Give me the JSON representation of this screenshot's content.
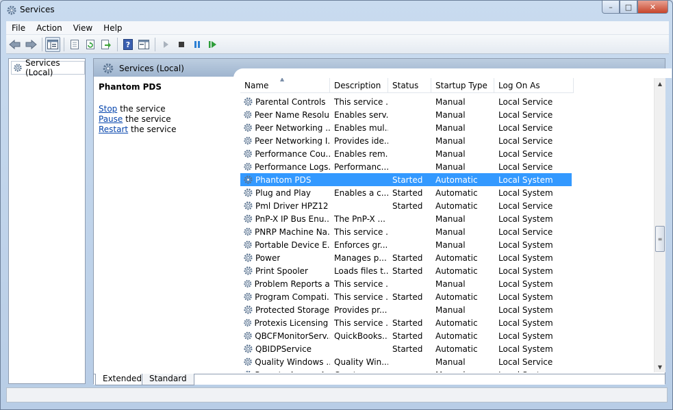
{
  "window": {
    "title": "Services",
    "icon": "services-gear-icon"
  },
  "caption": {
    "minimize": "–",
    "maximize": "□",
    "close": "✕"
  },
  "menu": [
    {
      "key": "file",
      "label": "File"
    },
    {
      "key": "action",
      "label": "Action"
    },
    {
      "key": "view",
      "label": "View"
    },
    {
      "key": "help",
      "label": "Help"
    }
  ],
  "toolbar": {
    "buttons": [
      "back-arrow-icon",
      "forward-arrow-icon",
      "show-hide-console-tree-icon",
      "properties-icon",
      "refresh-icon",
      "export-list-icon",
      "help-icon",
      "show-action-pane-icon",
      "start-service-icon",
      "stop-service-icon",
      "pause-service-icon",
      "restart-service-icon"
    ]
  },
  "tree": {
    "root_label": "Services (Local)"
  },
  "details": {
    "header_title": "Services (Local)",
    "service_name": "Phantom PDS",
    "actions": [
      {
        "link": "Stop",
        "rest": " the service"
      },
      {
        "link": "Pause",
        "rest": " the service"
      },
      {
        "link": "Restart",
        "rest": " the service"
      }
    ]
  },
  "list": {
    "columns": [
      "Name",
      "Description",
      "Status",
      "Startup Type",
      "Log On As"
    ],
    "rows": [
      {
        "name": "Parental Controls",
        "description": "This service ...",
        "status": "",
        "startup": "Manual",
        "logon": "Local Service"
      },
      {
        "name": "Peer Name Resolu...",
        "description": "Enables serv...",
        "status": "",
        "startup": "Manual",
        "logon": "Local Service"
      },
      {
        "name": "Peer Networking ...",
        "description": "Enables mul...",
        "status": "",
        "startup": "Manual",
        "logon": "Local Service"
      },
      {
        "name": "Peer Networking I...",
        "description": "Provides ide...",
        "status": "",
        "startup": "Manual",
        "logon": "Local Service"
      },
      {
        "name": "Performance Cou...",
        "description": "Enables rem...",
        "status": "",
        "startup": "Manual",
        "logon": "Local Service"
      },
      {
        "name": "Performance Logs...",
        "description": "Performanc...",
        "status": "",
        "startup": "Manual",
        "logon": "Local Service"
      },
      {
        "name": "Phantom PDS",
        "description": "",
        "status": "Started",
        "startup": "Automatic",
        "logon": "Local System",
        "selected": true
      },
      {
        "name": "Plug and Play",
        "description": "Enables a c...",
        "status": "Started",
        "startup": "Automatic",
        "logon": "Local System"
      },
      {
        "name": "Pml Driver HPZ12",
        "description": "",
        "status": "Started",
        "startup": "Automatic",
        "logon": "Local Service"
      },
      {
        "name": "PnP-X IP Bus Enu...",
        "description": "The PnP-X ...",
        "status": "",
        "startup": "Manual",
        "logon": "Local System"
      },
      {
        "name": "PNRP Machine Na...",
        "description": "This service ...",
        "status": "",
        "startup": "Manual",
        "logon": "Local Service"
      },
      {
        "name": "Portable Device E...",
        "description": "Enforces gr...",
        "status": "",
        "startup": "Manual",
        "logon": "Local System"
      },
      {
        "name": "Power",
        "description": "Manages p...",
        "status": "Started",
        "startup": "Automatic",
        "logon": "Local System"
      },
      {
        "name": "Print Spooler",
        "description": "Loads files t...",
        "status": "Started",
        "startup": "Automatic",
        "logon": "Local System"
      },
      {
        "name": "Problem Reports a...",
        "description": "This service ...",
        "status": "",
        "startup": "Manual",
        "logon": "Local System"
      },
      {
        "name": "Program Compati...",
        "description": "This service ...",
        "status": "Started",
        "startup": "Automatic",
        "logon": "Local System"
      },
      {
        "name": "Protected Storage",
        "description": "Provides pr...",
        "status": "",
        "startup": "Manual",
        "logon": "Local System"
      },
      {
        "name": "Protexis Licensing ...",
        "description": "This service ...",
        "status": "Started",
        "startup": "Automatic",
        "logon": "Local System"
      },
      {
        "name": "QBCFMonitorServ...",
        "description": "QuickBooks...",
        "status": "Started",
        "startup": "Automatic",
        "logon": "Local System"
      },
      {
        "name": "QBIDPService",
        "description": "",
        "status": "Started",
        "startup": "Automatic",
        "logon": "Local System"
      },
      {
        "name": "Quality Windows ...",
        "description": "Quality Win...",
        "status": "",
        "startup": "Manual",
        "logon": "Local Service"
      },
      {
        "name": "Remote Access A...",
        "description": "Creates a c...",
        "status": "",
        "startup": "Manual",
        "logon": "Local System"
      }
    ]
  },
  "tabs": [
    {
      "label": "Extended",
      "active": true
    },
    {
      "label": "Standard",
      "active": false
    }
  ],
  "colors": {
    "selection": "#3399ff",
    "link": "#0645ad"
  }
}
